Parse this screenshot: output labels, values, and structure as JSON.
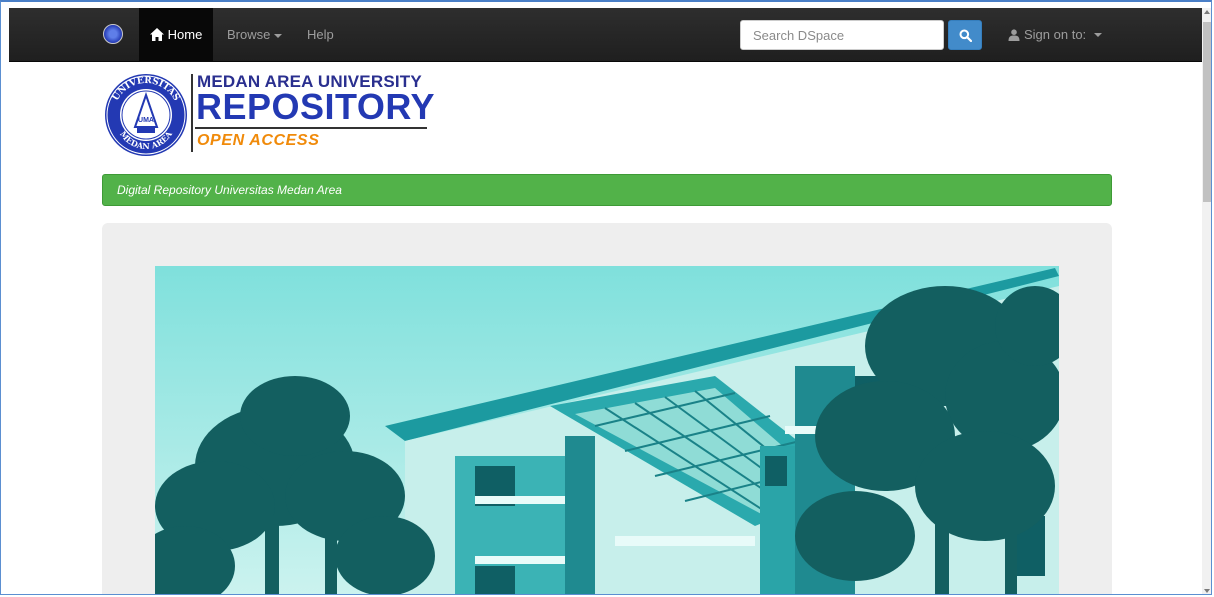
{
  "navbar": {
    "logo_icon": "university-seal-icon",
    "home_label": "Home",
    "home_icon": "home-icon",
    "browse_label": "Browse",
    "help_label": "Help",
    "search_placeholder": "Search DSpace",
    "search_icon": "search-icon",
    "signin_label": "Sign on to:",
    "signin_icon": "user-icon"
  },
  "header": {
    "seal_text_top": "UNIVERSITAS",
    "seal_text_bottom": "MEDAN AREA",
    "seal_center": "UMA",
    "university_name": "MEDAN AREA UNIVERSITY",
    "repository_title": "REPOSITORY",
    "tagline": "OPEN ACCESS",
    "colors": {
      "navy": "#2339b3",
      "orange": "#f08a0a"
    }
  },
  "banner": {
    "text": "Digital Repository Universitas Medan Area",
    "color": "#52b249"
  },
  "hero": {
    "image_description_icon": "campus-building-illustration"
  }
}
